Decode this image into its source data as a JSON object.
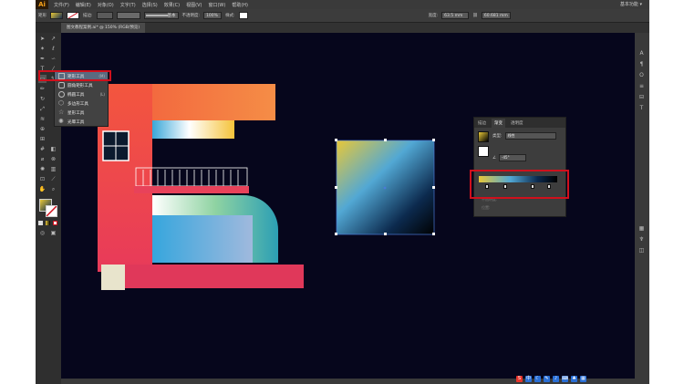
{
  "app": {
    "logo": "Ai",
    "workspace": "基本功能 ▾"
  },
  "menubar": {
    "items": [
      "文件(F)",
      "编辑(E)",
      "对象(O)",
      "文字(T)",
      "选择(S)",
      "效果(C)",
      "视图(V)",
      "窗口(W)",
      "帮助(H)"
    ]
  },
  "controlbar": {
    "selection_label": "矩形",
    "stroke_label": "描边:",
    "stroke_style": "基本",
    "opacity_label": "不透明度:",
    "opacity_value": "100%",
    "style_label": "样式:",
    "width_label": "宽度:",
    "width_value": "63.5 mm",
    "height_value": "60.681 mm"
  },
  "document_tab": {
    "title": "图文教程案例.ai* @ 150% (RGB/预览)"
  },
  "tool_flyout": {
    "items": [
      {
        "label": "矩形工具",
        "shortcut": "(M)"
      },
      {
        "label": "圆角矩形工具",
        "shortcut": ""
      },
      {
        "label": "椭圆工具",
        "shortcut": "(L)"
      },
      {
        "label": "多边形工具",
        "shortcut": ""
      },
      {
        "label": "星形工具",
        "shortcut": ""
      },
      {
        "label": "光晕工具",
        "shortcut": ""
      }
    ]
  },
  "gradient_panel": {
    "tabs": [
      "描边",
      "渐变",
      "透明度"
    ],
    "type_label": "类型:",
    "type_value": "线性",
    "angle_value": "-45°",
    "opacity_label": "不透明度:",
    "location_label": "位置:"
  },
  "colors": {
    "canvas_bg": "#06061c",
    "highlight": "#d0101c",
    "gradient_start": "#e8c838",
    "gradient_mid": "#52a8d4",
    "gradient_end": "#000000"
  },
  "taskbar_icons": [
    "sogou-icon",
    "chinese-icon",
    "moon-icon",
    "pen-icon",
    "mic-icon",
    "keyboard-icon",
    "shirt-icon",
    "grid-icon"
  ]
}
